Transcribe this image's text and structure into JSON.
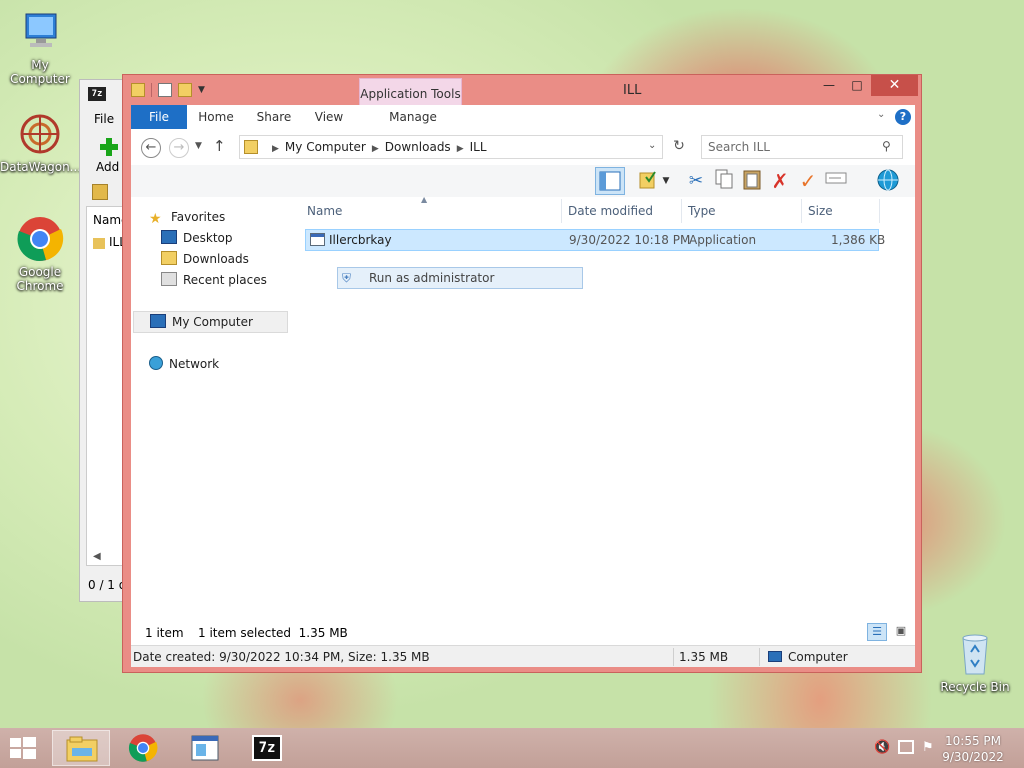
{
  "desktop": {
    "icons": [
      {
        "label": "My Computer"
      },
      {
        "label": "DataWagon..."
      },
      {
        "label": "Google Chrome"
      },
      {
        "label": "Recycle Bin"
      }
    ]
  },
  "bg_window": {
    "app_icon": "7z",
    "menu_file": "File",
    "add_label": "Add",
    "col_name": "Name",
    "row_label": "ILL",
    "status": "0 / 1 o"
  },
  "window": {
    "title": "ILL",
    "context_tab": "Application Tools",
    "tabs": {
      "file": "File",
      "home": "Home",
      "share": "Share",
      "view": "View",
      "manage": "Manage"
    },
    "breadcrumbs": [
      "My Computer",
      "Downloads",
      "ILL"
    ],
    "search_placeholder": "Search ILL"
  },
  "nav": {
    "favorites": "Favorites",
    "desktop": "Desktop",
    "downloads": "Downloads",
    "recent": "Recent places",
    "computer": "My Computer",
    "network": "Network"
  },
  "columns": {
    "name": "Name",
    "date": "Date modified",
    "type": "Type",
    "size": "Size"
  },
  "files": [
    {
      "name": "Illercbrkay",
      "date": "9/30/2022 10:18 PM",
      "type": "Application",
      "size": "1,386 KB"
    }
  ],
  "context_menu": {
    "run_as_admin": "Run as administrator"
  },
  "status": {
    "count": "1 item",
    "selected": "1 item selected  1.35 MB",
    "details": "Date created: 9/30/2022 10:34 PM, Size: 1.35 MB",
    "size": "1.35 MB",
    "location": "Computer"
  },
  "taskbar": {
    "time": "10:55 PM",
    "date": "9/30/2022",
    "seven_zip": "7z"
  }
}
